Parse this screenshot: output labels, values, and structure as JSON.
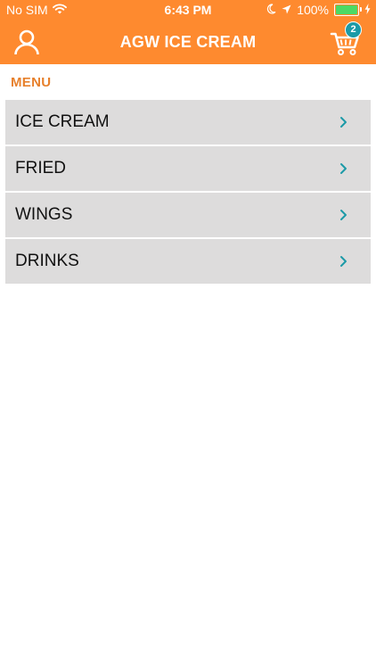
{
  "status_bar": {
    "carrier": "No SIM",
    "time": "6:43 PM",
    "battery": "100%",
    "battery_level": 1.0
  },
  "navbar": {
    "title": "AGW ICE CREAM",
    "user_icon": "user-icon",
    "cart_icon": "cart-icon",
    "cart_count": "2"
  },
  "section": {
    "label": "MENU"
  },
  "menu": {
    "items": [
      {
        "label": "ICE CREAM"
      },
      {
        "label": "FRIED"
      },
      {
        "label": "WINGS"
      },
      {
        "label": "DRINKS"
      }
    ]
  },
  "colors": {
    "header": "#fe8a2f",
    "accent": "#e7802c",
    "badge": "#1c9aa7",
    "chevron": "#1c9aa7",
    "row": "#dddcdc",
    "battery": "#4cd964"
  }
}
